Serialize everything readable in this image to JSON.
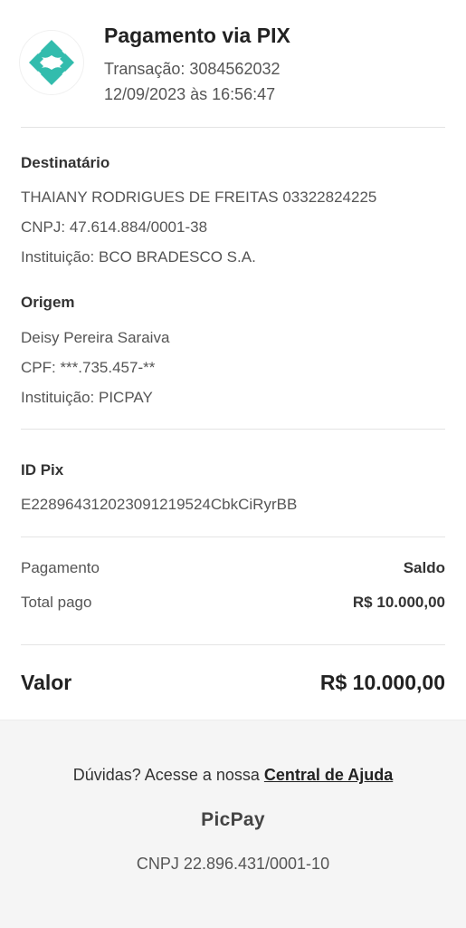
{
  "header": {
    "title": "Pagamento via PIX",
    "transaction": "Transação: 3084562032",
    "datetime": "12/09/2023 às 16:56:47",
    "logo_icon": "pix-logo-icon",
    "logo_color": "#32BCAD"
  },
  "destinatario": {
    "title": "Destinatário",
    "name": "THAIANY RODRIGUES DE FREITAS 03322824225",
    "cnpj": "CNPJ: 47.614.884/0001-38",
    "institution": "Instituição: BCO BRADESCO S.A."
  },
  "origem": {
    "title": "Origem",
    "name": "Deisy Pereira Saraiva",
    "cpf": "CPF: ***.735.457-**",
    "institution": "Instituição: PICPAY"
  },
  "id_pix": {
    "title": "ID Pix",
    "value": "E22896431202309121952​4CbkCiRyrBB"
  },
  "payment": {
    "method_label": "Pagamento",
    "method_value": "Saldo",
    "total_label": "Total pago",
    "total_value": "R$ 10.000,00"
  },
  "valor": {
    "label": "Valor",
    "value": "R$ 10.000,00"
  },
  "footer": {
    "help_prefix": "Dúvidas? Acesse a nossa ",
    "help_link": "Central de Ajuda",
    "brand": "PicPay",
    "cnpj": "CNPJ 22.896.431/0001-10"
  }
}
